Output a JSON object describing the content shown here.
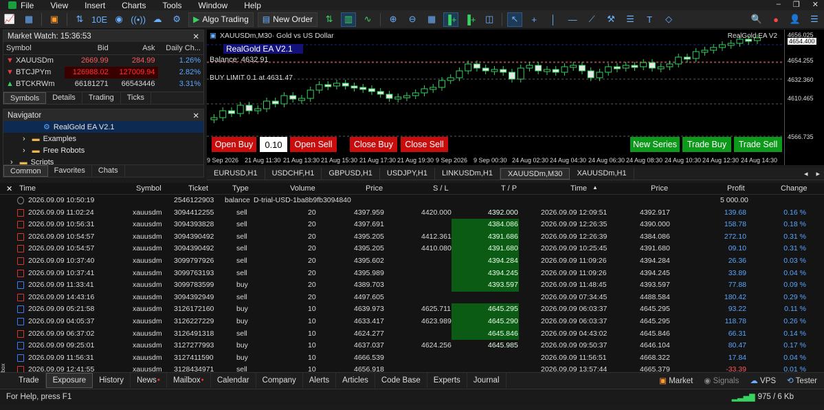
{
  "menu": [
    "File",
    "View",
    "Insert",
    "Charts",
    "Tools",
    "Window",
    "Help"
  ],
  "toolbar": {
    "algo_trading": "Algo Trading",
    "new_order": "New Order",
    "ten_e": "10E"
  },
  "market_watch": {
    "title": "Market Watch: 15:36:53",
    "columns": [
      "Symbol",
      "Bid",
      "Ask",
      "Daily Ch..."
    ],
    "rows": [
      {
        "symbol": "XAUUSDm",
        "bid": "2669.99",
        "ask": "284.99",
        "change": "1.26%",
        "color": "#e04040"
      },
      {
        "symbol": "BTCJPYm",
        "bid": "126988.02",
        "ask": "127009.94",
        "change": "2.82%",
        "color": "#e04040"
      },
      {
        "symbol": "BTCKRWm",
        "bid": "66181271",
        "ask": "66543446",
        "change": "3.31%",
        "color": "#39d15f"
      }
    ],
    "tabs": [
      "Symbols",
      "Details",
      "Trading",
      "Ticks"
    ]
  },
  "navigator": {
    "title": "Navigator",
    "items": [
      "RealGold EA V2.1",
      "Examples",
      "Free Robots",
      "Scripts"
    ],
    "tabs": [
      "Common",
      "Favorites",
      "Chats"
    ]
  },
  "chart": {
    "title": "XAUUSDm,M30·  Gold vs US Dollar",
    "ea_name": "RealGold EA V2.1",
    "ea_tag": "RealGold EA V2",
    "balance": "Balance: 4632.91",
    "buy_limit": "BUY LIMIT 0.1 at 4631.47",
    "buttons": {
      "open_buy": "Open Buy",
      "lot": "0.10",
      "open_sell": "Open Sell",
      "close_buy": "Close Buy",
      "close_sell": "Close Sell",
      "new_series": "New Series",
      "trade_buy": "Trade Buy",
      "trade_sell": "Trade Sell"
    },
    "prices": [
      "4656.025",
      "4654.255",
      "4632.360",
      "4610.465",
      "4566.735"
    ],
    "price_tag": "4654.400",
    "times": [
      "9 Sep 2026",
      "21 Aug 11:30",
      "21 Aug 13:30",
      "21 Aug 15:30",
      "21 Aug 17:30",
      "21 Aug 19:30",
      "9 Sep 2026",
      "9 Sep 00:30",
      "24 Aug 02:30",
      "24 Aug 04:30",
      "24 Aug 06:30",
      "24 Aug 08:30",
      "24 Aug 10:30",
      "24 Aug 12:30",
      "24 Aug 14:30"
    ]
  },
  "symbol_tabs": [
    "EURUSD,H1",
    "USDCHF,H1",
    "GBPUSD,H1",
    "USDJPY,H1",
    "LINKUSDm,H1",
    "XAUUSDm,M30",
    "XAUUSDm,H1"
  ],
  "trade": {
    "headers": [
      "Time",
      "Symbol",
      "Ticket",
      "Type",
      "Volume",
      "Price",
      "S / L",
      "T / P",
      "Time",
      "Price",
      "Profit",
      "Change"
    ],
    "balance_row": {
      "time": "2026.09.09 10:50:19",
      "ticket": "2546122903",
      "type": "balance",
      "comment": "D-trial-USD-1ba8b9fb3094840",
      "profit": "5 000.00"
    },
    "rows": [
      {
        "time": "2026.09.09 11:02:24",
        "symbol": "xauusdm",
        "ticket": "3094412255",
        "type": "sell",
        "volume": "20",
        "price": "4397.959",
        "sl": "4420.000",
        "tp": "4392.000",
        "time2": "2026.09.09 12:09:51",
        "price2": "4392.917",
        "profit": "139.68",
        "change": "0.16 %",
        "tp_hl": false
      },
      {
        "time": "2026.09.09 10:56:31",
        "symbol": "xauusdm",
        "ticket": "3094393828",
        "type": "sell",
        "volume": "20",
        "price": "4397.691",
        "sl": "",
        "tp": "4384.086",
        "time2": "2026.09.09 12:26:35",
        "price2": "4390.000",
        "profit": "158.78",
        "change": "0.18 %",
        "tp_hl": true
      },
      {
        "time": "2026.09.09 10:54:57",
        "symbol": "xauusdm",
        "ticket": "3094390492",
        "type": "sell",
        "volume": "20",
        "price": "4395.205",
        "sl": "4412.361",
        "tp": "4391.686",
        "time2": "2026.09.09 12:26:39",
        "price2": "4384.086",
        "profit": "272.10",
        "change": "0.31 %",
        "tp_hl": true
      },
      {
        "time": "2026.09.09 10:54:57",
        "symbol": "xauusdm",
        "ticket": "3094390492",
        "type": "sell",
        "volume": "20",
        "price": "4395.205",
        "sl": "4410.080",
        "tp": "4391.680",
        "time2": "2026.09.09 10:25:45",
        "price2": "4391.680",
        "profit": "09.10",
        "change": "0.31 %",
        "tp_hl": true
      },
      {
        "time": "2026.09.09 10:37:40",
        "symbol": "xauusdm",
        "ticket": "3099797926",
        "type": "sell",
        "volume": "20",
        "price": "4395.602",
        "sl": "",
        "tp": "4394.284",
        "time2": "2026.09.09 11:09:26",
        "price2": "4394.284",
        "profit": "26.36",
        "change": "0.03 %",
        "tp_hl": true
      },
      {
        "time": "2026.09.09 10:37:41",
        "symbol": "xauusdm",
        "ticket": "3099763193",
        "type": "sell",
        "volume": "20",
        "price": "4395.989",
        "sl": "",
        "tp": "4394.245",
        "time2": "2026.09.09 11:09:26",
        "price2": "4394.245",
        "profit": "33.89",
        "change": "0.04 %",
        "tp_hl": true
      },
      {
        "time": "2026.09.09 11:33:41",
        "symbol": "xauusdm",
        "ticket": "3099783599",
        "type": "buy",
        "volume": "20",
        "price": "4389.703",
        "sl": "",
        "tp": "4393.597",
        "time2": "2026.09.09 11:48:45",
        "price2": "4393.597",
        "profit": "77.88",
        "change": "0.09 %",
        "tp_hl": true
      },
      {
        "time": "2026.09.09 14:43:16",
        "symbol": "xauusdm",
        "ticket": "3094392949",
        "type": "sell",
        "volume": "20",
        "price": "4497.605",
        "sl": "",
        "tp": "",
        "time2": "2026.09.09 07:34:45",
        "price2": "4488.584",
        "profit": "180.42",
        "change": "0.29 %",
        "tp_hl": false
      },
      {
        "time": "2026.09.09 05:21:58",
        "symbol": "xauusdm",
        "ticket": "3126172160",
        "type": "buy",
        "volume": "10",
        "price": "4639.973",
        "sl": "4625.711",
        "tp": "4645.295",
        "time2": "2026.09.09 06:03:37",
        "price2": "4645.295",
        "profit": "93.22",
        "change": "0.11 %",
        "tp_hl": true
      },
      {
        "time": "2026.09.09 04:05:37",
        "symbol": "xauusdm",
        "ticket": "3126227229",
        "type": "buy",
        "volume": "10",
        "price": "4633.417",
        "sl": "4623.989",
        "tp": "4645.290",
        "time2": "2026.09.09 06:03:37",
        "price2": "4645.295",
        "profit": "118.78",
        "change": "0.26 %",
        "tp_hl": true
      },
      {
        "time": "2026.09.09 06:37:02",
        "symbol": "xauusdm",
        "ticket": "3126491318",
        "type": "sell",
        "volume": "10",
        "price": "4624.277",
        "sl": "",
        "tp": "4645.846",
        "time2": "2026.09.09 04:43:02",
        "price2": "4645.846",
        "profit": "66.31",
        "change": "0.14 %",
        "tp_hl": true
      },
      {
        "time": "2026.09.09 09:25:01",
        "symbol": "xauusdm",
        "ticket": "3127277993",
        "type": "buy",
        "volume": "10",
        "price": "4637.037",
        "sl": "4624.256",
        "tp": "4645.985",
        "time2": "2026.09.09 09:50:37",
        "price2": "4646.104",
        "profit": "80.47",
        "change": "0.17 %",
        "tp_hl": false
      },
      {
        "time": "2026.09.09 11:56:31",
        "symbol": "xauusdm",
        "ticket": "3127411590",
        "type": "buy",
        "volume": "10",
        "price": "4666.539",
        "sl": "",
        "tp": "",
        "time2": "2026.09.09 11:56:51",
        "price2": "4668.322",
        "profit": "17.84",
        "change": "0.04 %",
        "tp_hl": false
      },
      {
        "time": "2026.09.09 12:41:55",
        "symbol": "xauusdm",
        "ticket": "3128434971",
        "type": "sell",
        "volume": "10",
        "price": "4656.918",
        "sl": "",
        "tp": "",
        "time2": "2026.09.09 13:57:44",
        "price2": "4665.379",
        "profit": "-33.39",
        "change": "0.01 %",
        "tp_hl": false
      }
    ]
  },
  "bottom_tabs": [
    "Trade",
    "Exposure",
    "History",
    "News",
    "Mailbox",
    "Calendar",
    "Company",
    "Alerts",
    "Articles",
    "Code Base",
    "Experts",
    "Journal"
  ],
  "bottom_right": [
    "Market",
    "Signals",
    "VPS",
    "Tester"
  ],
  "toolbox_label": "Toolbox",
  "status": {
    "help": "For Help, press F1",
    "traffic": "975 / 6 Kb"
  }
}
